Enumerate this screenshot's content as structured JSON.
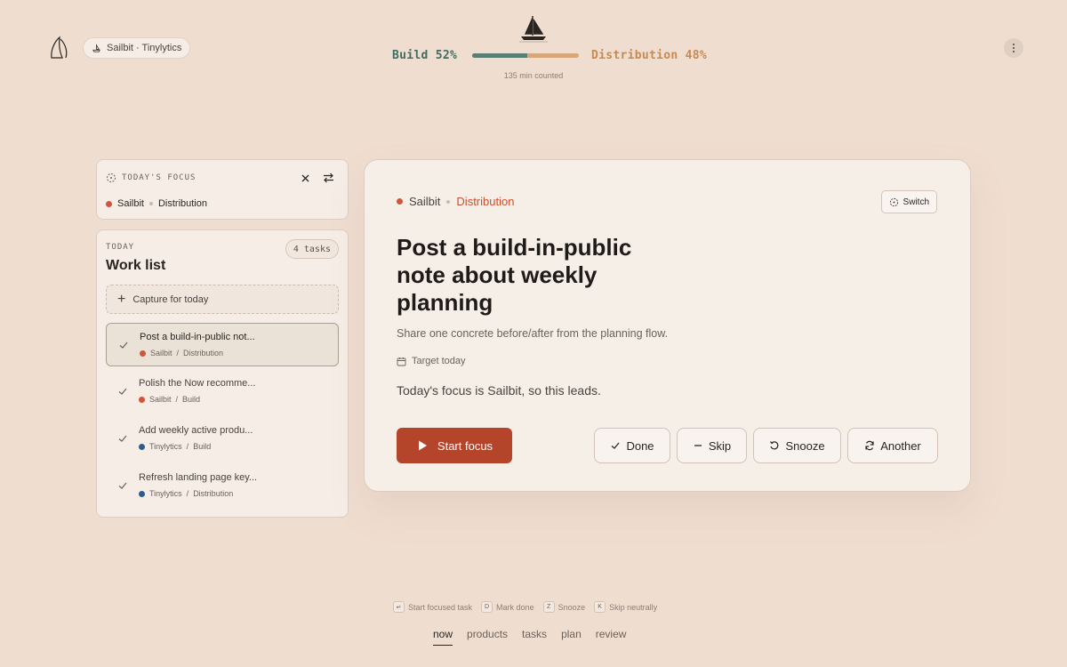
{
  "header": {
    "products_pill": "Sailbit · Tinylytics",
    "balance": {
      "build_label": "Build 52%",
      "distribution_label": "Distribution 48%",
      "build_fraction": 0.52,
      "counted_text": "135 min counted"
    },
    "menu_icon": "kebab-icon"
  },
  "focus_panel": {
    "heading": "TODAY'S FOCUS",
    "product": "Sailbit",
    "area": "Distribution",
    "product_color": "#d0553a"
  },
  "work_list": {
    "overline": "TODAY",
    "title": "Work list",
    "count": "4 tasks",
    "capture_label": "Capture for today",
    "tasks": [
      {
        "title": "Post a build-in-public not...",
        "product": "Sailbit",
        "area": "Distribution",
        "color": "#d0553a",
        "active": true
      },
      {
        "title": "Polish the Now recomme...",
        "product": "Sailbit",
        "area": "Build",
        "color": "#d0553a",
        "active": false
      },
      {
        "title": "Add weekly active produ...",
        "product": "Tinylytics",
        "area": "Build",
        "color": "#2e5d8c",
        "active": false
      },
      {
        "title": "Refresh landing page key...",
        "product": "Tinylytics",
        "area": "Distribution",
        "color": "#2e5d8c",
        "active": false
      }
    ]
  },
  "main": {
    "product": "Sailbit",
    "area": "Distribution",
    "switch_label": "Switch",
    "title": "Post a build-in-public note about weekly planning",
    "subtitle": "Share one concrete before/after from the planning flow.",
    "target": "Target today",
    "reason": "Today's focus is Sailbit, so this leads.",
    "start_label": "Start focus",
    "actions": {
      "done": "Done",
      "skip": "Skip",
      "snooze": "Snooze",
      "another": "Another"
    }
  },
  "shortcuts": [
    {
      "key": "↵",
      "label": "Start focused task"
    },
    {
      "key": "D",
      "label": "Mark done"
    },
    {
      "key": "Z",
      "label": "Snooze"
    },
    {
      "key": "K",
      "label": "Skip neutrally"
    }
  ],
  "nav": [
    "now",
    "products",
    "tasks",
    "plan",
    "review"
  ],
  "colors": {
    "accent": "#b5452a",
    "build": "#3e6e62",
    "distribution": "#c98a52",
    "background": "#efddd0"
  }
}
